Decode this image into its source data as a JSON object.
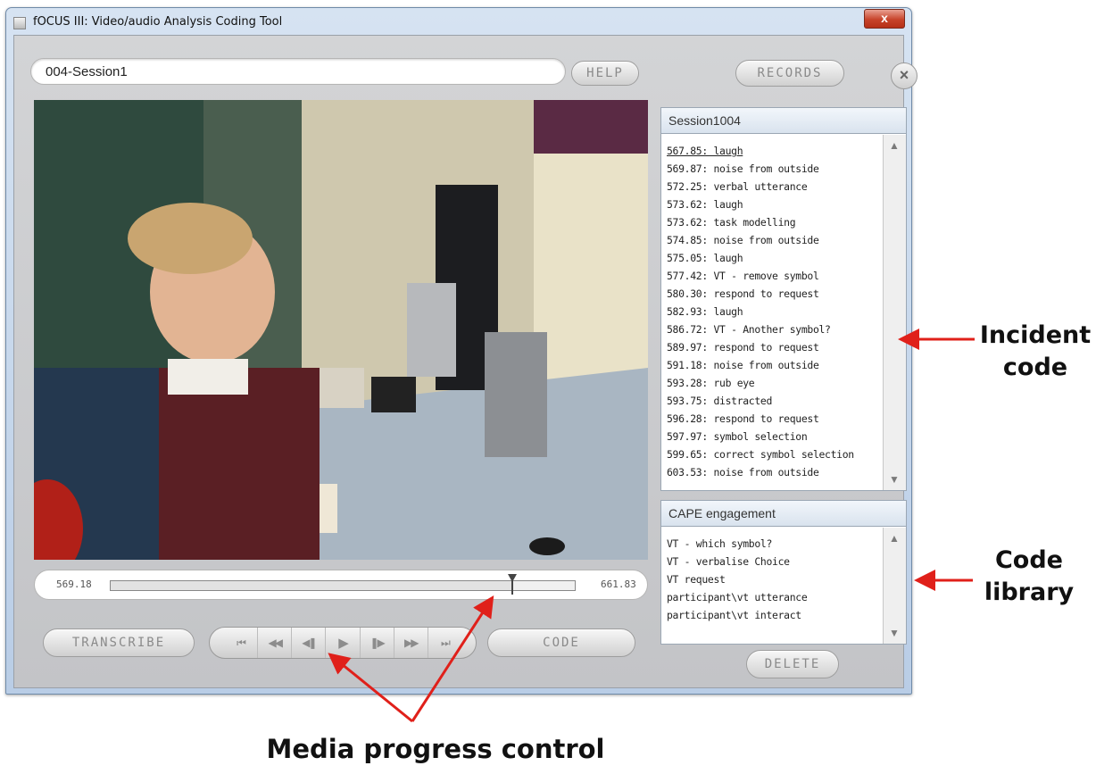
{
  "window": {
    "title": "fOCUS III: Video/audio Analysis Coding Tool",
    "close_glyph": "x"
  },
  "toolbar": {
    "session_value": "004-Session1",
    "help_label": "HELP",
    "records_label": "RECORDS",
    "close_glyph": "×"
  },
  "media": {
    "start_time": "569.18",
    "end_time": "661.83",
    "progress_fraction": 0.865
  },
  "transport": [
    {
      "icon": "skip-to-start-icon",
      "glyph": "⏮"
    },
    {
      "icon": "rewind-icon",
      "glyph": "◀◀"
    },
    {
      "icon": "step-back-icon",
      "glyph": "◀❚"
    },
    {
      "icon": "play-icon",
      "glyph": "▶"
    },
    {
      "icon": "step-forward-icon",
      "glyph": "❚▶"
    },
    {
      "icon": "fast-forward-icon",
      "glyph": "▶▶"
    },
    {
      "icon": "skip-to-end-icon",
      "glyph": "⏭"
    }
  ],
  "buttons": {
    "transcribe_label": "TRANSCRIBE",
    "code_label": "CODE",
    "delete_label": "DELETE"
  },
  "incidents": {
    "title": "Session1004",
    "items": [
      "567.85: laugh",
      "569.87: noise from outside",
      "572.25: verbal utterance",
      "573.62: laugh",
      "573.62: task modelling",
      "574.85: noise from outside",
      "575.05: laugh",
      "577.42: VT - remove symbol",
      "580.30: respond to request",
      "582.93: laugh",
      "586.72: VT - Another symbol?",
      "589.97: respond to request",
      "591.18: noise from outside",
      "593.28: rub eye",
      "593.75: distracted",
      "596.28: respond to request",
      "597.97: symbol selection",
      "599.65: correct symbol selection",
      "603.53: noise from outside"
    ]
  },
  "library": {
    "title": "CAPE engagement",
    "items": [
      "VT - which symbol?",
      "VT - verbalise Choice",
      "VT request",
      "participant\\vt utterance",
      "participant\\vt interact"
    ]
  },
  "scroll": {
    "up_glyph": "▲",
    "down_glyph": "▼"
  },
  "annotations": {
    "incident_line1": "Incident",
    "incident_line2": "code",
    "library_line1": "Code",
    "library_line2": "library",
    "media": "Media progress control",
    "arrow_color": "#e0201a"
  }
}
